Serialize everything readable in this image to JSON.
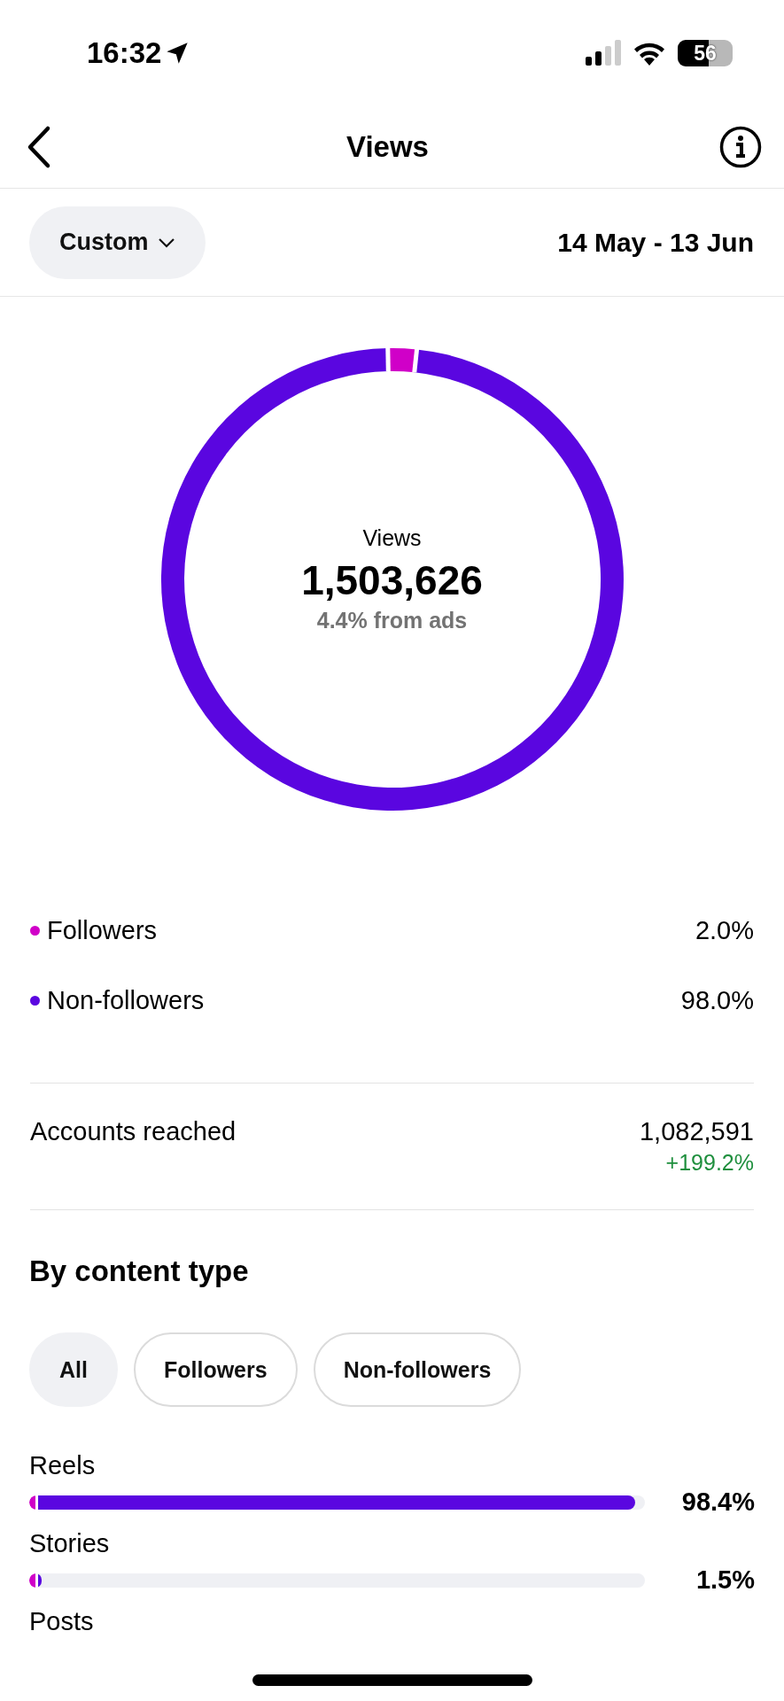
{
  "status_bar": {
    "time": "16:32",
    "battery": "56"
  },
  "header": {
    "title": "Views"
  },
  "filter": {
    "range": "Custom",
    "dates": "14 May - 13 Jun"
  },
  "summary": {
    "label": "Views",
    "total": "1,503,626",
    "note": "4.4% from ads",
    "chart_data": {
      "type": "donut",
      "values": [
        2.0,
        98.0
      ]
    }
  },
  "legend": [
    {
      "label": "Followers",
      "value": "2.0%",
      "color": "#d000c8"
    },
    {
      "label": "Non-followers",
      "value": "98.0%",
      "color": "#5a06e0"
    }
  ],
  "reach": {
    "label": "Accounts reached",
    "value": "1,082,591",
    "change": "+199.2%"
  },
  "content_type": {
    "title": "By content type",
    "chips": [
      {
        "label": "All",
        "selected": true
      },
      {
        "label": "Followers",
        "selected": false
      },
      {
        "label": "Non-followers",
        "selected": false
      }
    ],
    "rows": [
      {
        "label": "Reels",
        "value": "98.4%",
        "level": 0.984
      },
      {
        "label": "Stories",
        "value": "1.5%",
        "level": 0.015
      },
      {
        "label": "Posts"
      }
    ]
  }
}
